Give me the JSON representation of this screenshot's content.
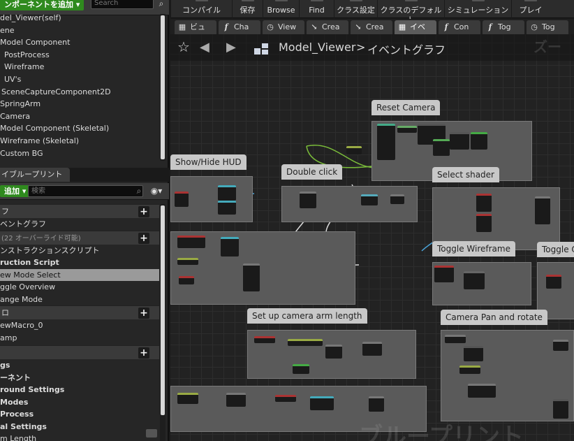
{
  "components": {
    "add_label": "ンポーネントを追加 ▾",
    "search_placeholder": "Search",
    "items": [
      "del_Viewer(self)",
      "ene",
      "Model Component",
      "PostProcess",
      "Wireframe",
      "UV's",
      "SceneCaptureComponent2D",
      "SpringArm",
      "Camera",
      "Model Component (Skeletal)",
      "Wireframe (Skeletal)",
      "Custom BG"
    ]
  },
  "blueprint": {
    "tab_label": "イブループリント",
    "tab_close": "×",
    "add_label": "追加 ▾",
    "search_placeholder": "検索",
    "sections": [
      {
        "header": "フ",
        "items": [
          {
            "label": "ベントグラフ"
          }
        ]
      },
      {
        "header": "(22 オーバーライド可能)",
        "items": [
          {
            "label": "ンストラクションスクリプト"
          },
          {
            "label": "ruction Script",
            "bold": true
          },
          {
            "label": "ew Mode Select",
            "selected": true
          },
          {
            "label": "ggle Overview"
          },
          {
            "label": "ange Mode"
          }
        ]
      },
      {
        "header": "ロ",
        "items": [
          {
            "label": "ewMacro_0"
          },
          {
            "label": "amp"
          }
        ]
      },
      {
        "header": "",
        "items": [
          {
            "label": "gs",
            "bold": true
          },
          {
            "label": "ーネント",
            "bold": true
          },
          {
            "label": "round Settings",
            "bold": true
          },
          {
            "label": "Modes",
            "bold": true
          },
          {
            "label": "Process",
            "bold": true
          },
          {
            "label": "al Settings",
            "bold": true
          },
          {
            "label": "m Length"
          }
        ]
      }
    ]
  },
  "toolbar": {
    "buttons": [
      "コンパイル",
      "保存",
      "Browse",
      "Find",
      "クラス設定",
      "クラスのデフォルト",
      "シミュレーション",
      "プレイ"
    ]
  },
  "doc_tabs": [
    {
      "icon": "grid-icon",
      "label": "ビュ"
    },
    {
      "icon": "function-icon",
      "label": "Cha"
    },
    {
      "icon": "clock-icon",
      "label": "View"
    },
    {
      "icon": "arrow-icon",
      "label": "Crea"
    },
    {
      "icon": "arrow-icon",
      "label": "Crea"
    },
    {
      "icon": "grid-icon",
      "label": "イベ",
      "active": true
    },
    {
      "icon": "function-icon",
      "label": "Con"
    },
    {
      "icon": "function-icon",
      "label": "Tog"
    },
    {
      "icon": "clock-icon",
      "label": "Tog"
    }
  ],
  "graph": {
    "breadcrumb_root": "Model_Viewer",
    "breadcrumb_sep": ">",
    "breadcrumb_current": "イベントグラフ",
    "zoom_watermark": "ズー",
    "bottom_watermark": "ブループリント",
    "comments": [
      "Reset Camera",
      "Show/Hide HUD",
      "Double click",
      "Select shader",
      "Toggle Wireframe",
      "Toggle Ov",
      "Set up camera arm length",
      "Camera Pan and rotate"
    ]
  }
}
